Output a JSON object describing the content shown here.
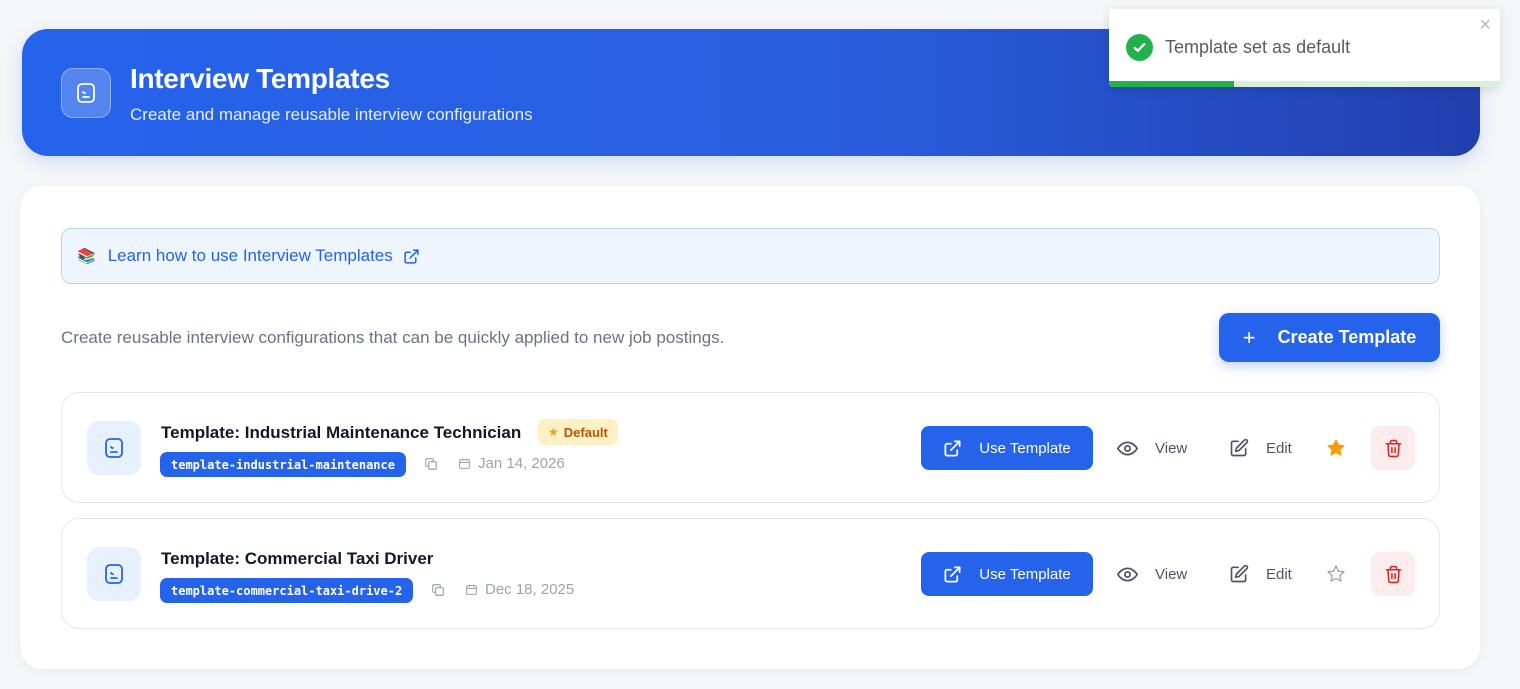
{
  "header": {
    "title": "Interview Templates",
    "subtitle": "Create and manage reusable interview configurations",
    "icon": "document-icon"
  },
  "toast": {
    "message": "Template set as default",
    "close": "×",
    "progress": 0.32,
    "color": "#22b24c"
  },
  "learn": {
    "emoji": "📚",
    "label": "Learn how to use Interview Templates"
  },
  "description": "Create reusable interview configurations that can be quickly applied to new job postings.",
  "create_button": {
    "plus": "+",
    "label": "Create Template"
  },
  "templates": [
    {
      "title": "Template: Industrial Maintenance Technician",
      "is_default": true,
      "default_label": "Default",
      "slug": "template-industrial-maintenance",
      "date": "Jan 14, 2026",
      "use_label": "Use Template",
      "view_label": "View",
      "edit_label": "Edit"
    },
    {
      "title": "Template: Commercial Taxi Driver",
      "is_default": false,
      "slug": "template-commercial-taxi-drive-2",
      "date": "Dec 18, 2025",
      "use_label": "Use Template",
      "view_label": "View",
      "edit_label": "Edit"
    }
  ],
  "colors": {
    "primary": "#2563eb",
    "star_active": "#f59e0b",
    "danger": "#dc2626",
    "success": "#22b24c"
  }
}
